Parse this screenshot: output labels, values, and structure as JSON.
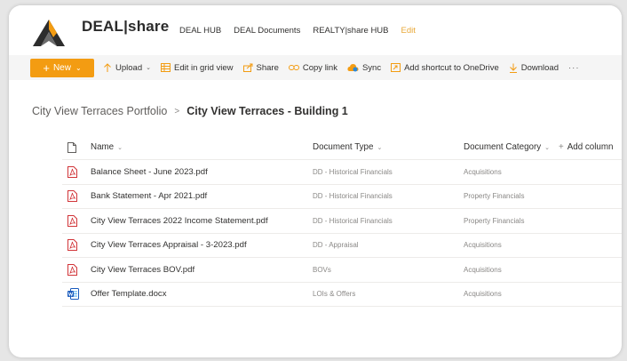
{
  "nav": {
    "brand": "DEAL|share",
    "links": [
      "DEAL HUB",
      "DEAL Documents",
      "REALTY|share HUB"
    ],
    "edit": "Edit"
  },
  "commands": {
    "new": "New",
    "upload": "Upload",
    "edit_grid": "Edit in grid view",
    "share": "Share",
    "copy_link": "Copy link",
    "sync": "Sync",
    "add_shortcut": "Add shortcut to OneDrive",
    "download": "Download",
    "more": "···"
  },
  "breadcrumb": {
    "parent": "City View Terraces Portfolio",
    "separator": ">",
    "current": "City View Terraces - Building 1"
  },
  "table": {
    "headers": {
      "name": "Name",
      "type": "Document Type",
      "category": "Document Category",
      "add_column": "Add column"
    },
    "rows": [
      {
        "icon": "pdf",
        "name": "Balance Sheet - June 2023.pdf",
        "type": "DD - Historical Financials",
        "category": "Acquisitions"
      },
      {
        "icon": "pdf",
        "name": "Bank Statement - Apr 2021.pdf",
        "type": "DD - Historical Financials",
        "category": "Property Financials"
      },
      {
        "icon": "pdf",
        "name": "City View Terraces 2022 Income Statement.pdf",
        "type": "DD - Historical Financials",
        "category": "Property Financials"
      },
      {
        "icon": "pdf",
        "name": "City View Terraces Appraisal - 3-2023.pdf",
        "type": "DD - Appraisal",
        "category": "Acquisitions"
      },
      {
        "icon": "pdf",
        "name": "City View Terraces BOV.pdf",
        "type": "BOVs",
        "category": "Acquisitions"
      },
      {
        "icon": "docx",
        "name": "Offer Template.docx",
        "type": "LOIs & Offers",
        "category": "Acquisitions"
      }
    ]
  },
  "colors": {
    "accent": "#f39c12",
    "pdf": "#d13438",
    "word": "#185abd"
  }
}
